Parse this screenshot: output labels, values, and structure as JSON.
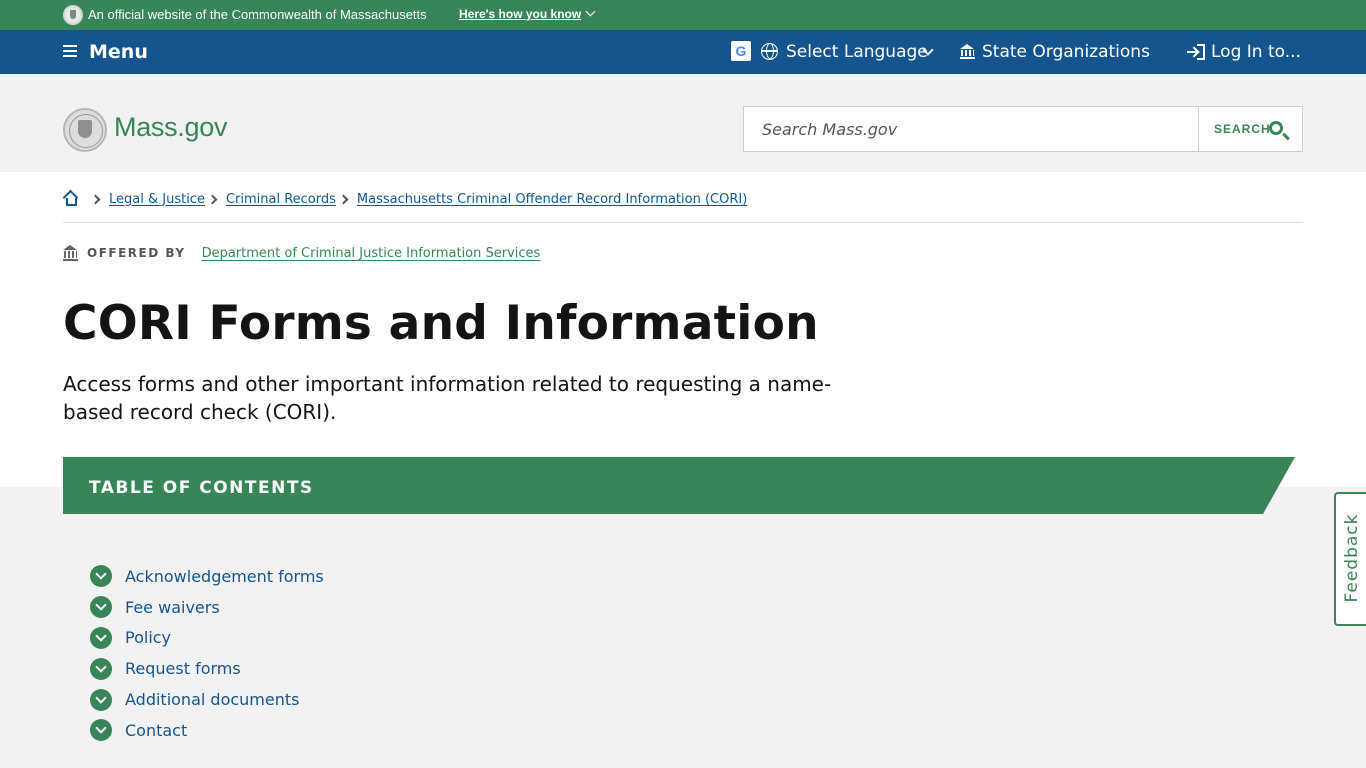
{
  "official_banner": {
    "text": "An official website of the Commonwealth of Massachusetts",
    "how_link": "Here's how you know"
  },
  "utility_nav": {
    "menu_label": "Menu",
    "google_letter": "G",
    "language_label": "Select Language",
    "state_orgs_label": "State Organizations",
    "login_label": "Log In to..."
  },
  "header": {
    "logo_text": "Mass.gov",
    "search_placeholder": "Search Mass.gov",
    "search_button": "SEARCH"
  },
  "breadcrumb": {
    "items": [
      "Legal & Justice",
      "Criminal Records",
      "Massachusetts Criminal Offender Record Information (CORI)"
    ]
  },
  "offered_by": {
    "label": "OFFERED BY",
    "org": "Department of Criminal Justice Information Services"
  },
  "page": {
    "title": "CORI Forms and Information",
    "lede": "Access forms and other important information related to requesting a name-based record check (CORI)."
  },
  "toc": {
    "title": "TABLE OF CONTENTS",
    "items": [
      "Acknowledgement forms",
      "Fee waivers",
      "Policy",
      "Request forms",
      "Additional documents",
      "Contact"
    ]
  },
  "feedback": {
    "label": "Feedback"
  },
  "colors": {
    "green": "#388557",
    "blue": "#14558f",
    "grey_bg": "#f2f2f2"
  }
}
